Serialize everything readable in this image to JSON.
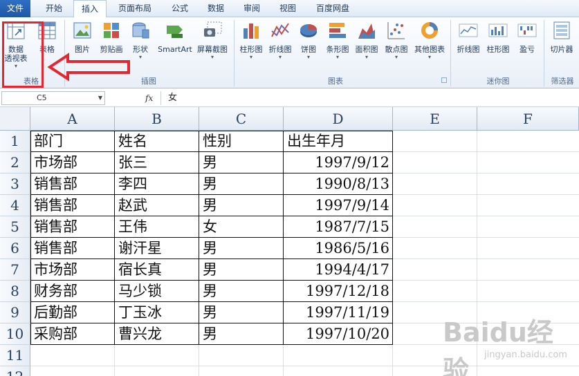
{
  "tabs": [
    {
      "id": "file",
      "label": "文件"
    },
    {
      "id": "home",
      "label": "开始"
    },
    {
      "id": "insert",
      "label": "插入",
      "active": true
    },
    {
      "id": "layout",
      "label": "页面布局"
    },
    {
      "id": "formulas",
      "label": "公式"
    },
    {
      "id": "data",
      "label": "数据"
    },
    {
      "id": "review",
      "label": "审阅"
    },
    {
      "id": "view",
      "label": "视图"
    },
    {
      "id": "baidu",
      "label": "百度网盘"
    }
  ],
  "ribbon": {
    "groups": {
      "tables": "表格",
      "illustrations": "插图",
      "charts": "图表",
      "sparklines": "迷你图",
      "filter": "筛选器"
    },
    "buttons": {
      "pivot_line1": "数据",
      "pivot_line2": "透视表",
      "table": "表格",
      "picture": "图片",
      "clipart": "剪贴画",
      "shapes": "形状",
      "smartart": "SmartArt",
      "screenshot": "屏幕截图",
      "column_chart": "柱形图",
      "line_chart": "折线图",
      "pie_chart": "饼图",
      "bar_chart": "条形图",
      "area_chart": "面积图",
      "scatter_chart": "散点图",
      "other_charts": "其他图表",
      "spark_line": "折线图",
      "spark_column": "柱形图",
      "spark_winloss": "盈亏",
      "slicer": "切片器"
    }
  },
  "formula_bar": {
    "name_box": "C5",
    "fx": "fx",
    "value": "女"
  },
  "sheet": {
    "columns": [
      "A",
      "B",
      "C",
      "D",
      "E",
      "F"
    ],
    "rows": [
      "1",
      "2",
      "3",
      "4",
      "5",
      "6",
      "7",
      "8",
      "9",
      "10",
      "11",
      "12"
    ],
    "headers": [
      "部门",
      "姓名",
      "性别",
      "出生年月"
    ],
    "data": [
      [
        "市场部",
        "张三",
        "男",
        "1997/9/12"
      ],
      [
        "销售部",
        "李四",
        "男",
        "1990/8/13"
      ],
      [
        "销售部",
        "赵武",
        "男",
        "1997/9/14"
      ],
      [
        "销售部",
        "王伟",
        "女",
        "1987/7/15"
      ],
      [
        "销售部",
        "谢汗星",
        "男",
        "1986/5/16"
      ],
      [
        "市场部",
        "宿长真",
        "男",
        "1994/4/17"
      ],
      [
        "财务部",
        "马少锁",
        "男",
        "1997/12/18"
      ],
      [
        "后勤部",
        "丁玉冰",
        "男",
        "1997/11/19"
      ],
      [
        "采购部",
        "曹兴龙",
        "男",
        "1997/10/20"
      ]
    ]
  },
  "watermark": {
    "main": "Baidu经验",
    "sub": "jingyan.baidu.com"
  },
  "colors": {
    "annotation": "#e3262f",
    "file_tab": "#2e6fc4"
  }
}
